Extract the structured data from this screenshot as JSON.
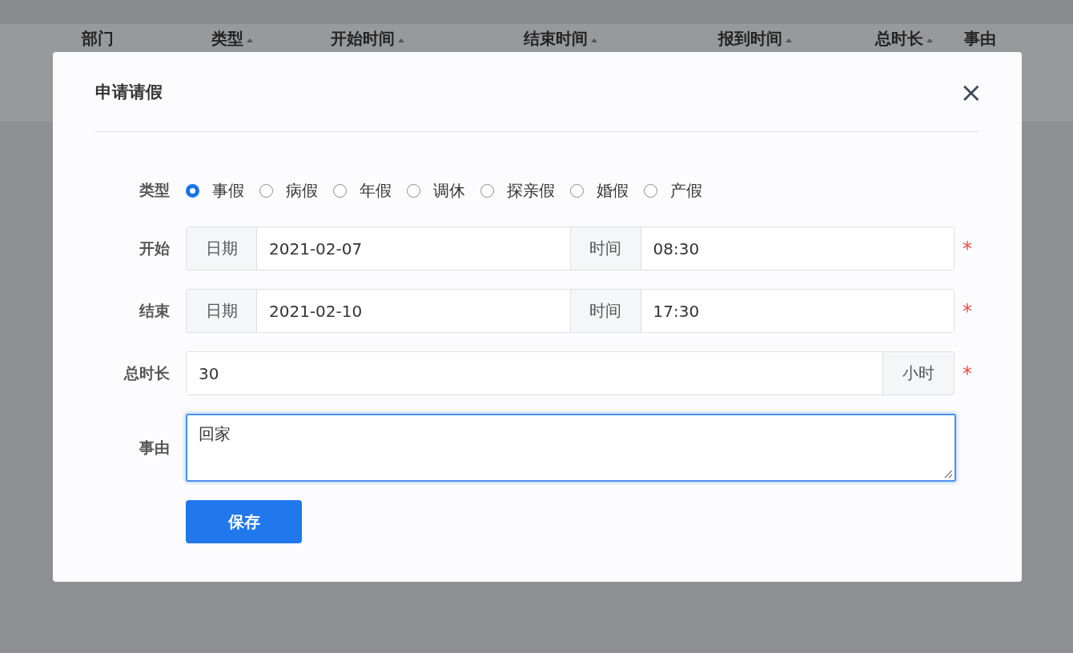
{
  "table_header": [
    {
      "label": "部门",
      "sortable": false
    },
    {
      "label": "类型",
      "sortable": true
    },
    {
      "label": "开始时间",
      "sortable": true
    },
    {
      "label": "结束时间",
      "sortable": true
    },
    {
      "label": "报到时间",
      "sortable": true
    },
    {
      "label": "总时长",
      "sortable": true
    },
    {
      "label": "事由",
      "sortable": false
    }
  ],
  "dialog": {
    "title": "申请请假",
    "close": "×",
    "type_field": {
      "label": "类型",
      "options": [
        {
          "label": "事假",
          "selected": true
        },
        {
          "label": "病假",
          "selected": false
        },
        {
          "label": "年假",
          "selected": false
        },
        {
          "label": "调休",
          "selected": false
        },
        {
          "label": "探亲假",
          "selected": false
        },
        {
          "label": "婚假",
          "selected": false
        },
        {
          "label": "产假",
          "selected": false
        }
      ]
    },
    "rows": [
      {
        "kind": "datetime",
        "label": "开始",
        "date_addon": "日期",
        "date": "2021-02-07",
        "time_addon": "时间",
        "time": "08:30",
        "required_mark": "*"
      },
      {
        "kind": "datetime",
        "label": "结束",
        "date_addon": "日期",
        "date": "2021-02-10",
        "time_addon": "时间",
        "time": "17:30",
        "required_mark": "*"
      },
      {
        "kind": "duration",
        "label": "总时长",
        "value": "30",
        "suffix": "小时",
        "required_mark": "*"
      }
    ],
    "reason": {
      "label": "事由",
      "value": "回家",
      "focused": true
    },
    "save_button": "保存"
  }
}
